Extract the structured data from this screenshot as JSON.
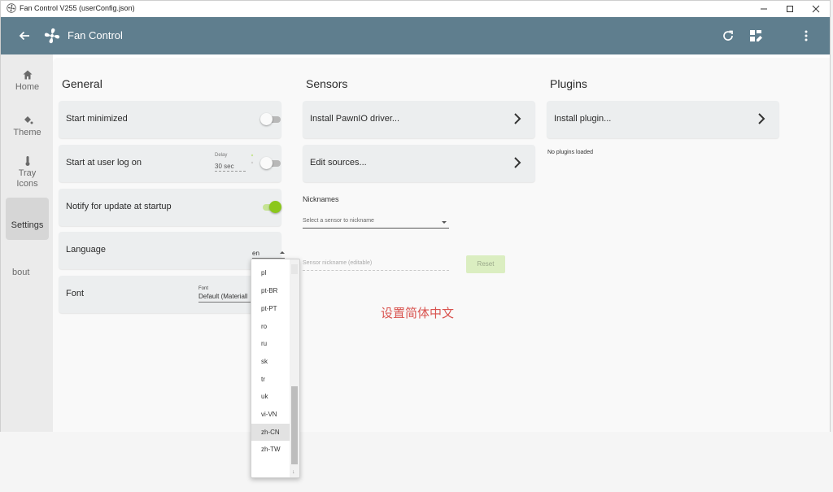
{
  "window": {
    "title": "Fan Control V255 (userConfig.json)"
  },
  "appbar": {
    "title": "Fan Control"
  },
  "nav": {
    "items": [
      {
        "label": "Home",
        "icon": "home-icon"
      },
      {
        "label": "Theme",
        "icon": "paint-bucket-icon"
      },
      {
        "label": "Tray Icons",
        "icon": "thermometer-icon"
      },
      {
        "label": "Settings",
        "icon": "none"
      },
      {
        "label": "bout",
        "icon": "none"
      }
    ],
    "active": "Settings"
  },
  "general": {
    "title": "General",
    "start_minimized": {
      "label": "Start minimized",
      "on": false
    },
    "start_logon": {
      "label": "Start at user log on",
      "on": false,
      "delay_label": "Delay",
      "delay_value": "30 sec"
    },
    "notify_update": {
      "label": "Notify for update at startup",
      "on": true
    },
    "language": {
      "label": "Language",
      "value": "en"
    },
    "font": {
      "label": "Font",
      "field_label": "Font",
      "value": "Default (Materiall"
    }
  },
  "sensors": {
    "title": "Sensors",
    "install_pawnio": "Install PawnIO driver...",
    "edit_sources": "Edit sources...",
    "nicknames": {
      "title": "Nicknames",
      "select_placeholder": "Select a sensor to nickname",
      "input_placeholder": "Sensor nickname (editable)",
      "reset_label": "Reset"
    }
  },
  "plugins": {
    "title": "Plugins",
    "install_plugin": "Install plugin...",
    "status": "No plugins loaded"
  },
  "language_dropdown": {
    "options": [
      "pl",
      "pt-BR",
      "pt-PT",
      "ro",
      "ru",
      "sk",
      "tr",
      "uk",
      "vi-VN",
      "zh-CN",
      "zh-TW"
    ],
    "highlighted": "zh-CN"
  },
  "annotation": "设置简体中文",
  "colors": {
    "appbar": "#5f7e8e",
    "accent_green": "#8bc71c",
    "annotation_red": "#d9534f"
  }
}
